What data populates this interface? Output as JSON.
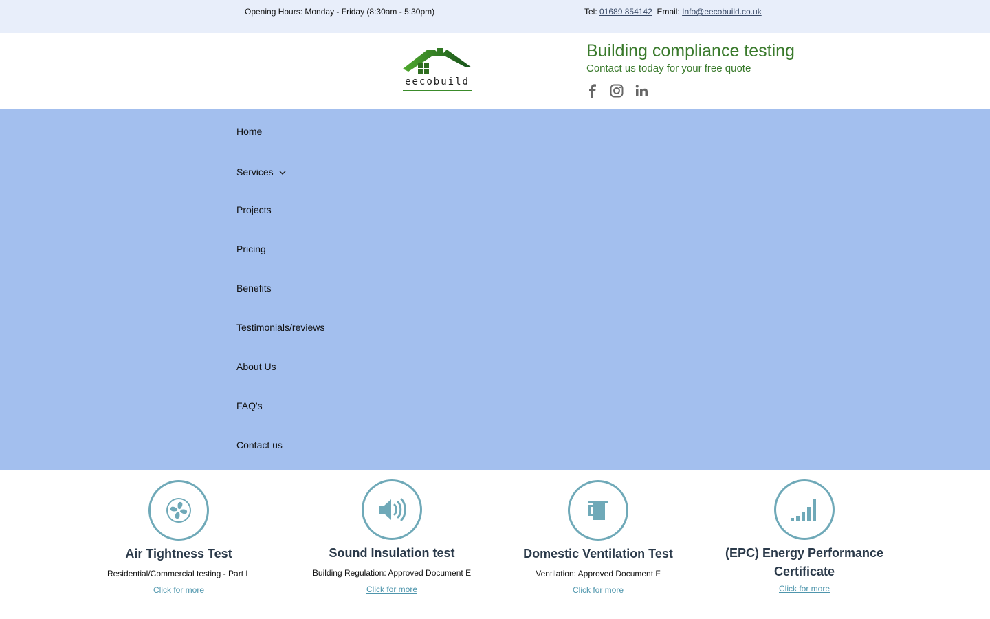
{
  "topbar": {
    "hours": "Opening Hours: Monday - Friday (8:30am - 5:30pm)",
    "tel_label": "Tel: ",
    "tel": "01689 854142",
    "email_label": "Email: ",
    "email": "Info@eecobuild.co.uk"
  },
  "header": {
    "logo_text": "eecobuild",
    "title": "Building compliance testing",
    "subtitle": "Contact us today for your free quote",
    "social": [
      "facebook-icon",
      "instagram-icon",
      "linkedin-icon"
    ]
  },
  "nav": {
    "items": [
      {
        "label": "Home"
      },
      {
        "label": "Services"
      },
      {
        "label": "Projects"
      },
      {
        "label": "Pricing"
      },
      {
        "label": "Benefits"
      },
      {
        "label": "Testimonials/reviews"
      },
      {
        "label": "About Us"
      },
      {
        "label": "FAQ's"
      },
      {
        "label": "Contact us"
      }
    ]
  },
  "services": [
    {
      "title": "Air Tightness Test",
      "desc": "Residential/Commercial testing - Part L",
      "link": "Click for more",
      "icon": "fan-icon"
    },
    {
      "title": "Sound Insulation test",
      "desc": "Building Regulation: Approved Document E",
      "link": "Click for more",
      "icon": "speaker-icon"
    },
    {
      "title": "Domestic Ventilation Test",
      "desc": "Ventilation: Approved Document F",
      "link": "Click for more",
      "icon": "ventilation-icon"
    },
    {
      "title": "(EPC) Energy Performance Certificate",
      "desc": "",
      "link": "Click for more",
      "icon": "signal-bars-icon"
    }
  ],
  "colors": {
    "topbar_bg": "#e8eefa",
    "nav_bg": "#a3bfee",
    "brand_green": "#3a7a2c",
    "icon_teal": "#6fa9b8"
  }
}
